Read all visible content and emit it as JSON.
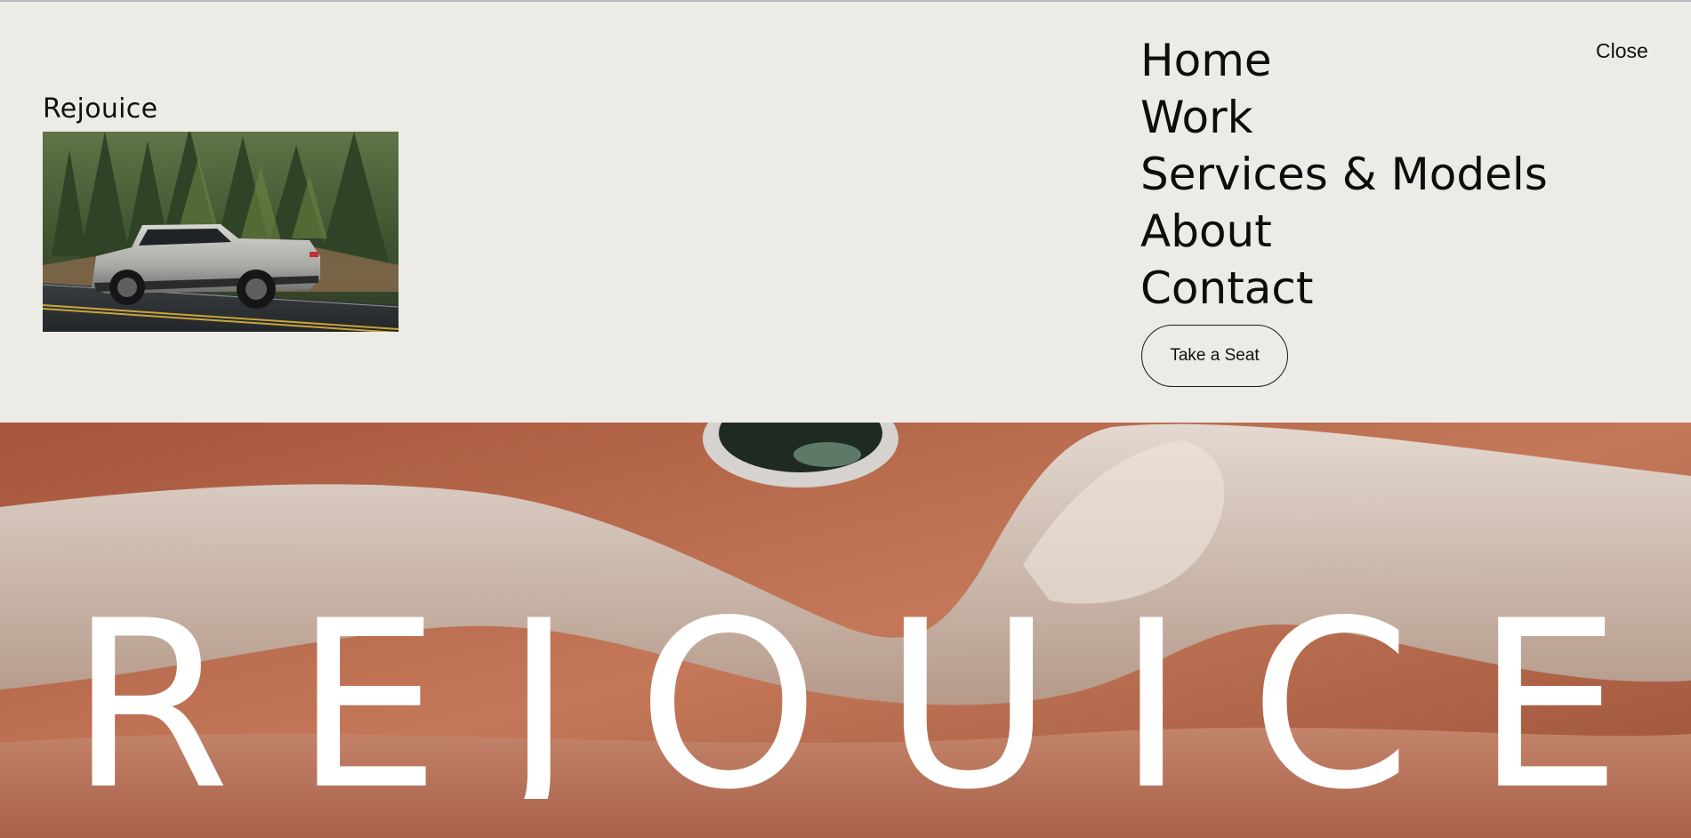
{
  "brand": {
    "name": "Rejouice"
  },
  "nav": {
    "items": [
      {
        "label": "Home"
      },
      {
        "label": "Work"
      },
      {
        "label": "Services & Models"
      },
      {
        "label": "About"
      },
      {
        "label": "Contact"
      }
    ],
    "cta_label": "Take a Seat",
    "close_label": "Close"
  },
  "hero": {
    "wordmark": "REJOUICE"
  },
  "colors": {
    "panel_bg": "#ecebe6",
    "hero_bg": "#b76b4d",
    "text": "#111111",
    "wordmark": "#ffffff"
  }
}
